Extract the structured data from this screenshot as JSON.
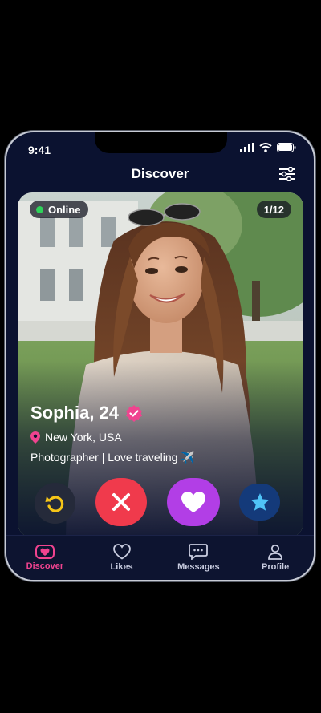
{
  "status": {
    "time": "9:41"
  },
  "header": {
    "title": "Discover"
  },
  "card": {
    "online_label": "Online",
    "counter": "1/12",
    "name": "Sophia, 24",
    "location": "New York, USA",
    "bio": "Photographer | Love traveling ✈️"
  },
  "tabs": [
    {
      "label": "Discover",
      "icon": "heart-badge-icon",
      "active": true
    },
    {
      "label": "Likes",
      "icon": "heart-outline-icon",
      "active": false
    },
    {
      "label": "Messages",
      "icon": "chat-bubble-icon",
      "active": false
    },
    {
      "label": "Profile",
      "icon": "person-icon",
      "active": false
    }
  ],
  "colors": {
    "background": "#0b1230",
    "accent_pink": "#f0438f",
    "online_green": "#2fd25a",
    "nope_red": "#f03a4c",
    "like_purple": "#b23ee6",
    "superlike_blue": "#143a7a",
    "rewind_yellow": "#f5c518"
  }
}
